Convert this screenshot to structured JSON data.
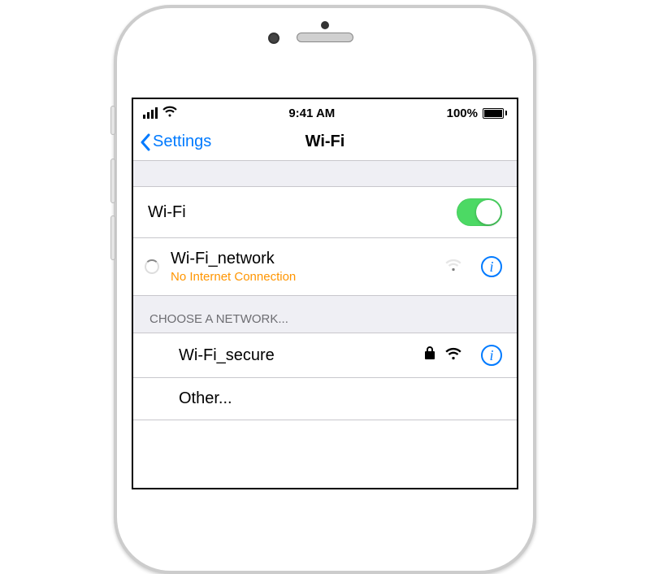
{
  "status": {
    "time": "9:41 AM",
    "battery_pct": "100%"
  },
  "nav": {
    "back_label": "Settings",
    "title": "Wi-Fi"
  },
  "wifi_row": {
    "label": "Wi-Fi"
  },
  "connected": {
    "ssid": "Wi-Fi_network",
    "status": "No Internet Connection"
  },
  "section_choose": "CHOOSE A NETWORK...",
  "networks": [
    {
      "ssid": "Wi-Fi_secure"
    }
  ],
  "other_label": "Other..."
}
